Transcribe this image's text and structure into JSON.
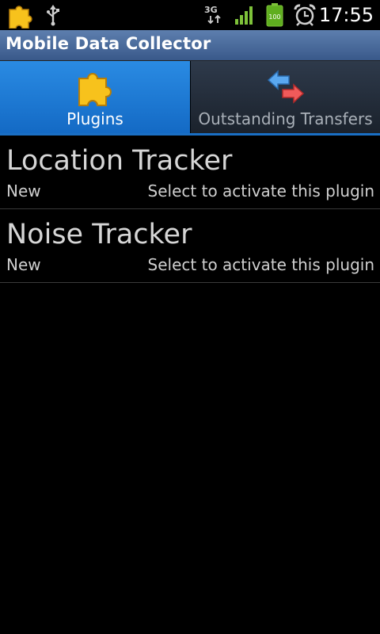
{
  "status_bar": {
    "network_label": "3G",
    "battery_level": "100",
    "time": "17:55",
    "icons": [
      "puzzle-icon",
      "usb-icon",
      "network-3g-icon",
      "signal-icon",
      "battery-icon",
      "alarm-icon"
    ]
  },
  "app": {
    "title": "Mobile Data Collector"
  },
  "tabs": [
    {
      "label": "Plugins",
      "icon": "puzzle-icon",
      "selected": true
    },
    {
      "label": "Outstanding Transfers",
      "icon": "transfer-arrows-icon",
      "selected": false
    }
  ],
  "plugins": [
    {
      "name": "Location Tracker",
      "status": "New",
      "hint": "Select to activate this plugin"
    },
    {
      "name": "Noise Tracker",
      "status": "New",
      "hint": "Select to activate this plugin"
    }
  ],
  "colors": {
    "title_bar": "#4a6b9d",
    "tab_active": "#1f7fd8",
    "tab_inactive": "#252e3a",
    "puzzle": "#f7c21c"
  }
}
